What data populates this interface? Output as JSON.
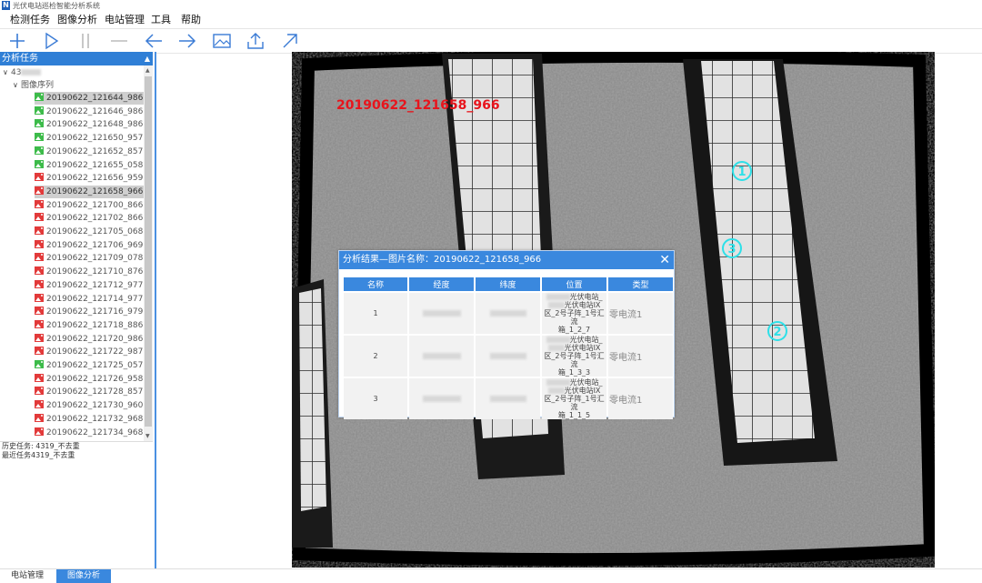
{
  "app": {
    "title": "光伏电站巡检智能分析系统",
    "logo": "N"
  },
  "menu": [
    "检测任务",
    "图像分析",
    "电站管理",
    "工具",
    "帮助"
  ],
  "toolbar": [
    {
      "icon": "plus-icon"
    },
    {
      "icon": "play-icon"
    },
    {
      "icon": "pause-icon"
    },
    {
      "icon": "minus-icon"
    },
    {
      "icon": "arrow-left-icon"
    },
    {
      "icon": "arrow-right-icon"
    },
    {
      "icon": "image-icon"
    },
    {
      "icon": "upload-icon"
    },
    {
      "icon": "arrow-up-right-icon"
    }
  ],
  "tree": {
    "header": "分析任务",
    "root_prefix": "43",
    "group_label": "图像序列",
    "items": [
      {
        "name": "20190622_121644_986",
        "status": "green",
        "selected": true
      },
      {
        "name": "20190622_121646_986",
        "status": "green"
      },
      {
        "name": "20190622_121648_986",
        "status": "green"
      },
      {
        "name": "20190622_121650_957",
        "status": "green"
      },
      {
        "name": "20190622_121652_857",
        "status": "green"
      },
      {
        "name": "20190622_121655_058",
        "status": "green"
      },
      {
        "name": "20190622_121656_959",
        "status": "red"
      },
      {
        "name": "20190622_121658_966",
        "status": "red",
        "selected": true
      },
      {
        "name": "20190622_121700_866",
        "status": "red"
      },
      {
        "name": "20190622_121702_866",
        "status": "red"
      },
      {
        "name": "20190622_121705_068",
        "status": "red"
      },
      {
        "name": "20190622_121706_969",
        "status": "red"
      },
      {
        "name": "20190622_121709_078",
        "status": "red"
      },
      {
        "name": "20190622_121710_876",
        "status": "red"
      },
      {
        "name": "20190622_121712_977",
        "status": "red"
      },
      {
        "name": "20190622_121714_977",
        "status": "red"
      },
      {
        "name": "20190622_121716_979",
        "status": "red"
      },
      {
        "name": "20190622_121718_886",
        "status": "red"
      },
      {
        "name": "20190622_121720_986",
        "status": "red"
      },
      {
        "name": "20190622_121722_987",
        "status": "red"
      },
      {
        "name": "20190622_121725_057",
        "status": "green"
      },
      {
        "name": "20190622_121726_958",
        "status": "red"
      },
      {
        "name": "20190622_121728_857",
        "status": "red"
      },
      {
        "name": "20190622_121730_960",
        "status": "red"
      },
      {
        "name": "20190622_121732_968",
        "status": "red"
      },
      {
        "name": "20190622_121734_968",
        "status": "red"
      }
    ]
  },
  "history": [
    "历史任务: 4319_不去重",
    "最近任务4319_不去重"
  ],
  "bottom_tabs": [
    {
      "label": "电站管理",
      "active": false
    },
    {
      "label": "图像分析",
      "active": true
    }
  ],
  "viewer": {
    "image_label": "20190622_121658_966",
    "markers": [
      "1",
      "2",
      "3"
    ]
  },
  "dialog": {
    "title": "分析结果—图片名称：20190622_121658_966",
    "columns": [
      "名称",
      "经度",
      "纬度",
      "位置",
      "类型"
    ],
    "rows": [
      {
        "name": "1",
        "lon": "",
        "lat": "",
        "loc": [
          "光伏电站_",
          "光伏电站IX",
          "区_2号子阵_1号汇流",
          "箱_1_2_7"
        ],
        "type": "零电流1"
      },
      {
        "name": "2",
        "lon": "",
        "lat": "",
        "loc": [
          "光伏电站_",
          "光伏电站IX",
          "区_2号子阵_1号汇流",
          "箱_1_3_3"
        ],
        "type": "零电流1"
      },
      {
        "name": "3",
        "lon": "",
        "lat": "",
        "loc": [
          "光伏电站_",
          "光伏电站IX",
          "区_2号子阵_1号汇流",
          "箱_1_1_5"
        ],
        "type": "零电流1"
      }
    ]
  },
  "colors": {
    "accent": "#3a88de",
    "marker": "#2de0e8",
    "label_red": "#e8141c"
  }
}
